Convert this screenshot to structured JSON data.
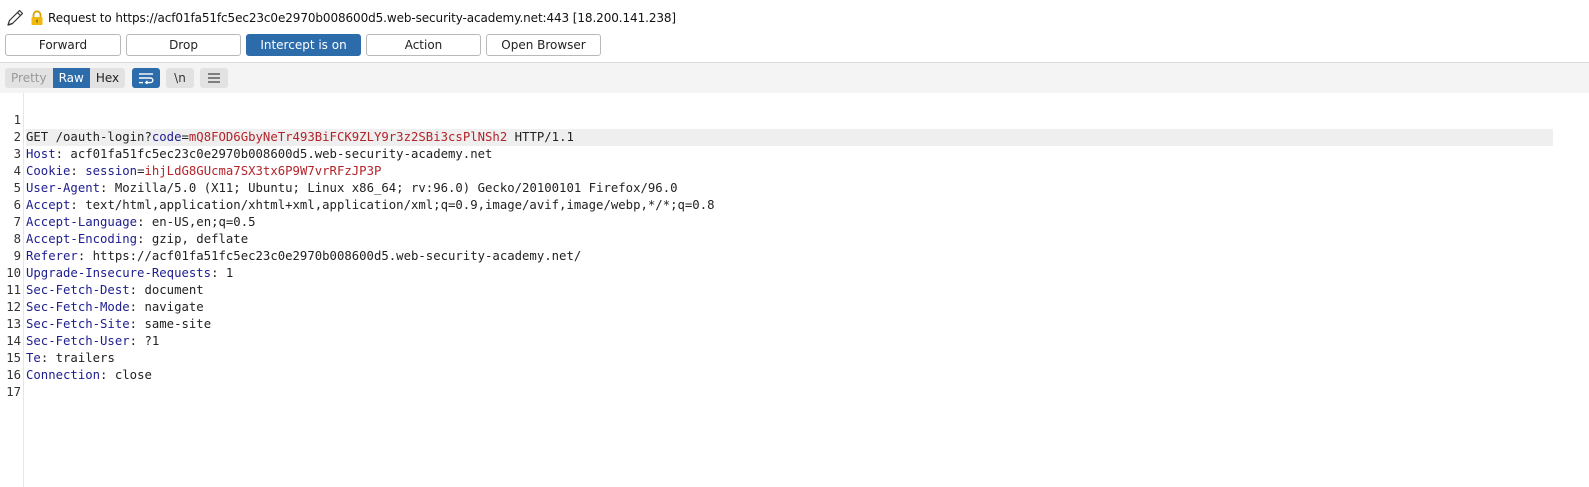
{
  "title": {
    "text": "Request to https://acf01fa51fc5ec23c0e2970b008600d5.web-security-academy.net:443  [18.200.141.238]",
    "edit_icon": "pencil-icon",
    "lock_icon": "lock-icon"
  },
  "buttons": {
    "forward": "Forward",
    "drop": "Drop",
    "intercept": "Intercept is on",
    "action": "Action",
    "open_browser": "Open Browser"
  },
  "toolbar": {
    "pretty": "Pretty",
    "raw": "Raw",
    "hex": "Hex",
    "wrap_icon": "wrap-lines-icon",
    "newline_label": "\\n",
    "menu_icon": "hamburger-menu-icon"
  },
  "colors": {
    "accent": "#2d6cab",
    "header_name": "#1d1d8e",
    "param_value": "#b3232a"
  },
  "request": {
    "line1": {
      "prefix": "GET /oauth-login?",
      "param_name": "code",
      "eq": "=",
      "param_value": "mQ8FOD6GbyNeTr493BiFCK9ZLY9r3z2SBi3csPlNSh2",
      "suffix": " HTTP/1.1"
    },
    "host": {
      "name": "Host",
      "value": ": acf01fa51fc5ec23c0e2970b008600d5.web-security-academy.net"
    },
    "cookie": {
      "name": "Cookie",
      "sep": ": ",
      "cookie_name": "session",
      "eq": "=",
      "cookie_value": "ihjLdG8GUcma7SX3tx6P9W7vrRFzJP3P"
    },
    "user_agent": {
      "name": "User-Agent",
      "value": ": Mozilla/5.0 (X11; Ubuntu; Linux x86_64; rv:96.0) Gecko/20100101 Firefox/96.0"
    },
    "accept": {
      "name": "Accept",
      "value": ": text/html,application/xhtml+xml,application/xml;q=0.9,image/avif,image/webp,*/*;q=0.8"
    },
    "accept_language": {
      "name": "Accept-Language",
      "value": ": en-US,en;q=0.5"
    },
    "accept_encoding": {
      "name": "Accept-Encoding",
      "value": ": gzip, deflate"
    },
    "referer": {
      "name": "Referer",
      "value": ": https://acf01fa51fc5ec23c0e2970b008600d5.web-security-academy.net/"
    },
    "upgrade": {
      "name": "Upgrade-Insecure-Requests",
      "value": ": 1"
    },
    "sec_dest": {
      "name": "Sec-Fetch-Dest",
      "value": ": document"
    },
    "sec_mode": {
      "name": "Sec-Fetch-Mode",
      "value": ": navigate"
    },
    "sec_site": {
      "name": "Sec-Fetch-Site",
      "value": ": same-site"
    },
    "sec_user": {
      "name": "Sec-Fetch-User",
      "value": ": ?1"
    },
    "te": {
      "name": "Te",
      "value": ": trailers"
    },
    "connection": {
      "name": "Connection",
      "value": ": close"
    }
  },
  "line_numbers": [
    "1",
    "2",
    "3",
    "4",
    "5",
    "6",
    "7",
    "8",
    "9",
    "10",
    "11",
    "12",
    "13",
    "14",
    "15",
    "16",
    "17"
  ]
}
